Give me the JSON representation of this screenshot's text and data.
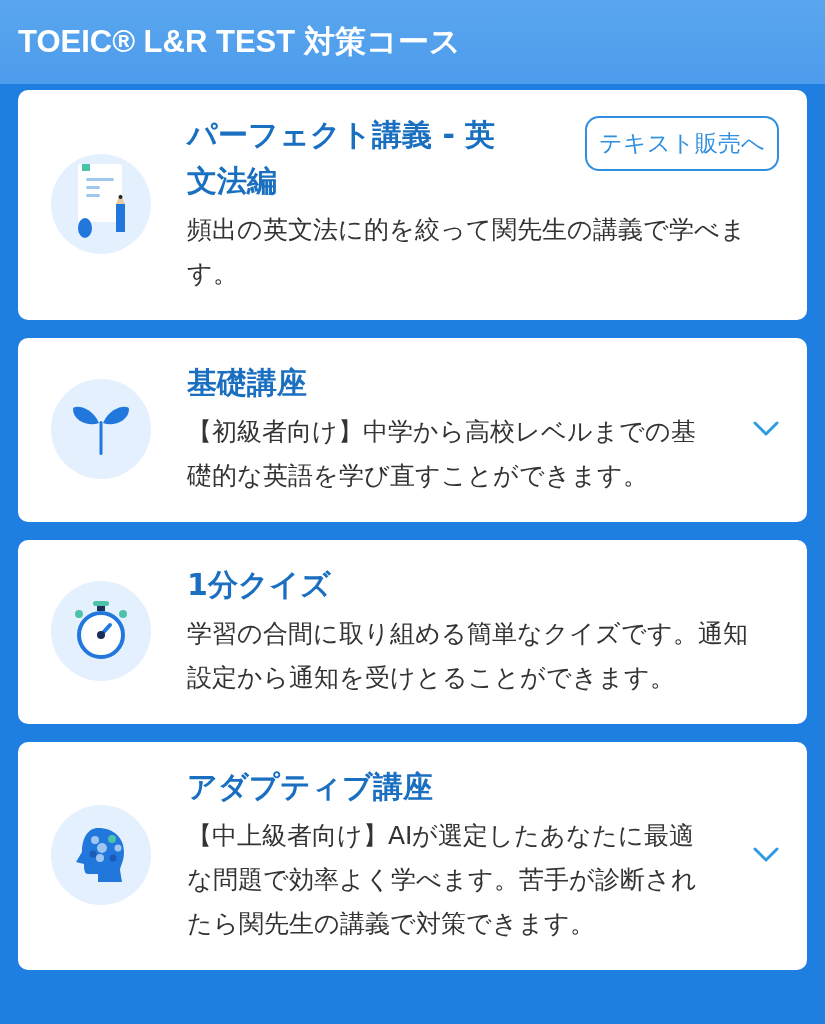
{
  "header": {
    "title": "TOEIC® L&R TEST 対策コース"
  },
  "courses": [
    {
      "title": "パーフェクト講義 - 英文法編",
      "description": "頻出の英文法に的を絞って関先生の講義で学べます。",
      "action": {
        "kind": "button",
        "label": "テキスト販売へ"
      }
    },
    {
      "title": "基礎講座",
      "description": "【初級者向け】中学から高校レベルまでの基礎的な英語を学び直すことができます。",
      "action": {
        "kind": "expand",
        "expanded": false
      }
    },
    {
      "title": "1分クイズ",
      "description": "学習の合間に取り組める簡単なクイズです。通知設定から通知を受けとることができます。"
    },
    {
      "title": "アダプティブ講座",
      "description": "【中上級者向け】AIが選定したあなたに最適な問題で効率よく学べます。苦手が診断されたら関先生の講義で対策できます。",
      "action": {
        "kind": "expand",
        "expanded": false
      }
    }
  ]
}
